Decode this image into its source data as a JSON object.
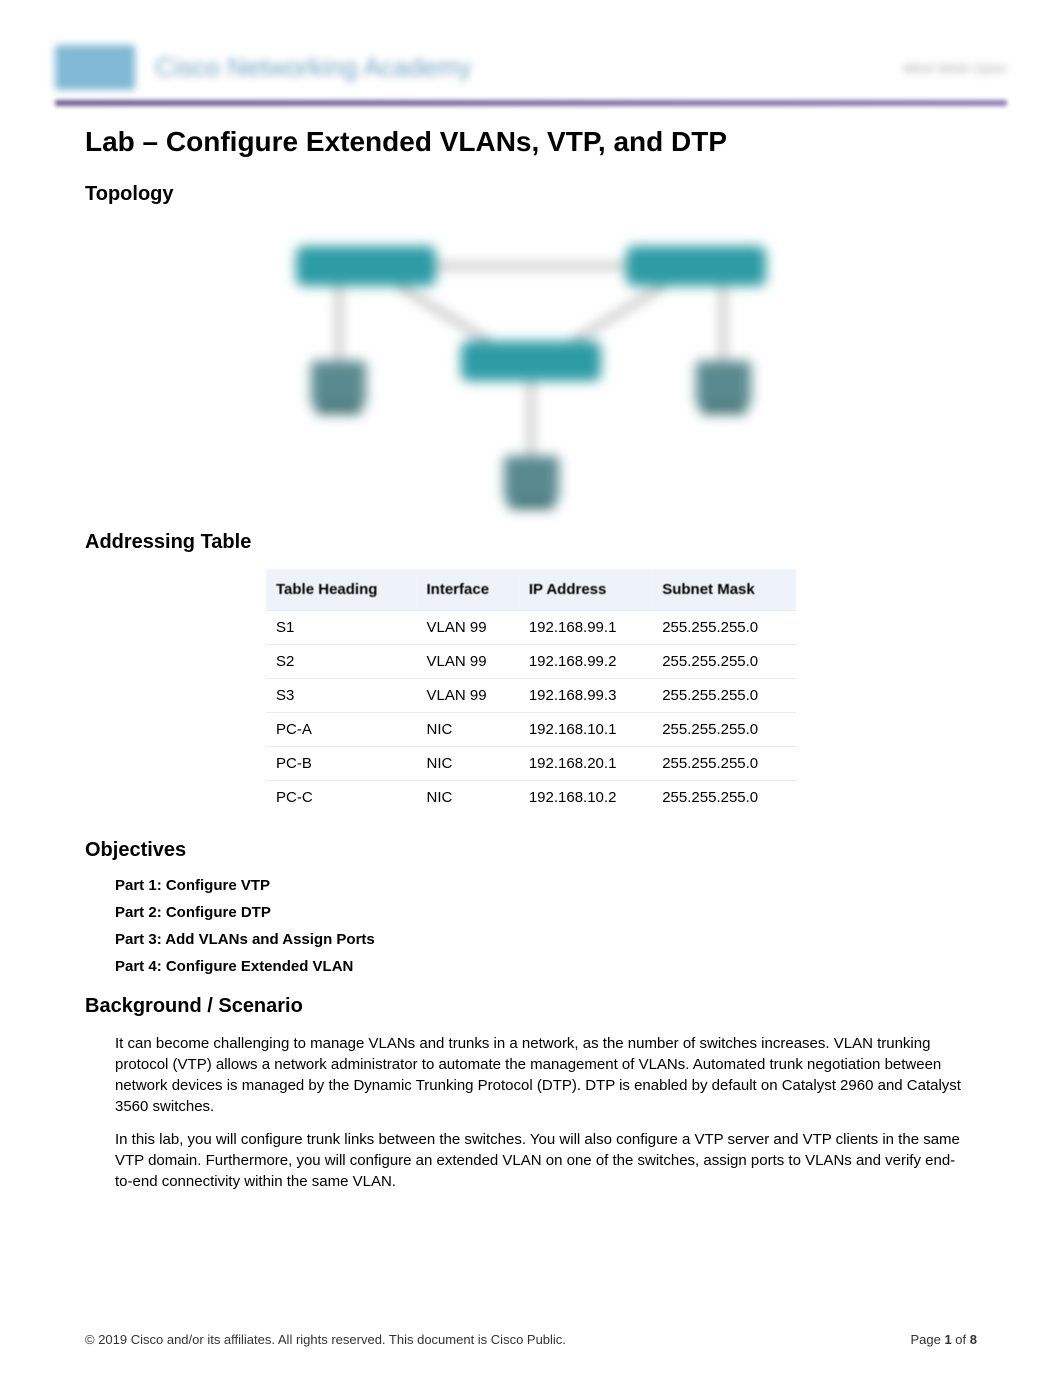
{
  "header": {
    "academy_text": "Cisco Networking Academy",
    "tagline": "Mind Wide Open"
  },
  "title": "Lab – Configure Extended VLANs, VTP, and DTP",
  "sections": {
    "topology": "Topology",
    "addressing": "Addressing Table",
    "objectives": "Objectives",
    "background": "Background / Scenario"
  },
  "addressing_table": {
    "headers": [
      "Table Heading",
      "Interface",
      "IP Address",
      "Subnet Mask"
    ],
    "rows": [
      {
        "device": "S1",
        "interface": "VLAN 99",
        "ip": "192.168.99.1",
        "mask": "255.255.255.0"
      },
      {
        "device": "S2",
        "interface": "VLAN 99",
        "ip": "192.168.99.2",
        "mask": "255.255.255.0"
      },
      {
        "device": "S3",
        "interface": "VLAN 99",
        "ip": "192.168.99.3",
        "mask": "255.255.255.0"
      },
      {
        "device": "PC-A",
        "interface": "NIC",
        "ip": "192.168.10.1",
        "mask": "255.255.255.0"
      },
      {
        "device": "PC-B",
        "interface": "NIC",
        "ip": "192.168.20.1",
        "mask": "255.255.255.0"
      },
      {
        "device": "PC-C",
        "interface": "NIC",
        "ip": "192.168.10.2",
        "mask": "255.255.255.0"
      }
    ]
  },
  "objectives": [
    "Part 1: Configure VTP",
    "Part 2: Configure DTP",
    "Part 3: Add VLANs and Assign Ports",
    "Part 4: Configure Extended VLAN"
  ],
  "background_paragraphs": [
    "It can become challenging to manage VLANs and trunks in a network, as the number of switches increases. VLAN trunking protocol (VTP) allows a network administrator to automate the management of VLANs. Automated trunk negotiation between network devices is managed by the Dynamic Trunking Protocol (DTP). DTP is enabled by default on Catalyst 2960 and Catalyst 3560 switches.",
    "In this lab, you will configure trunk links between the switches. You will also configure a VTP server and VTP clients in the same VTP domain. Furthermore, you will configure an extended VLAN on one of the switches, assign ports to VLANs and verify end-to-end connectivity within the same VLAN."
  ],
  "footer": {
    "copyright": "© 2019 Cisco and/or its affiliates. All rights reserved. This document is Cisco Public.",
    "page_label_prefix": "Page ",
    "page_current": "1",
    "page_of": " of ",
    "page_total": "8"
  }
}
